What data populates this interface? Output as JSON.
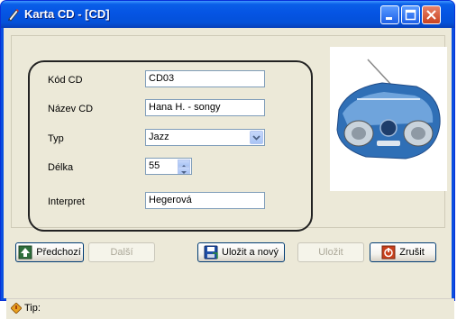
{
  "window": {
    "title": "Karta CD - [CD]"
  },
  "form": {
    "code_label": "Kód CD",
    "code_value": "CD03",
    "name_label": "Název CD",
    "name_value": "Hana H. - songy",
    "type_label": "Typ",
    "type_value": "Jazz",
    "length_label": "Délka",
    "length_value": "55",
    "interpret_label": "Interpret",
    "interpret_value": "Hegerová"
  },
  "buttons": {
    "previous": "Předchozí",
    "next": "Další",
    "save_new": "Uložit a nový",
    "save": "Uložit",
    "cancel": "Zrušit"
  },
  "status": {
    "tip_label": "Tip:"
  },
  "icons": {
    "app": "pencil-icon",
    "previous": "arrow-up-icon",
    "save_new": "floppy-disk-icon",
    "cancel": "power-icon",
    "tip": "diamond-icon"
  }
}
